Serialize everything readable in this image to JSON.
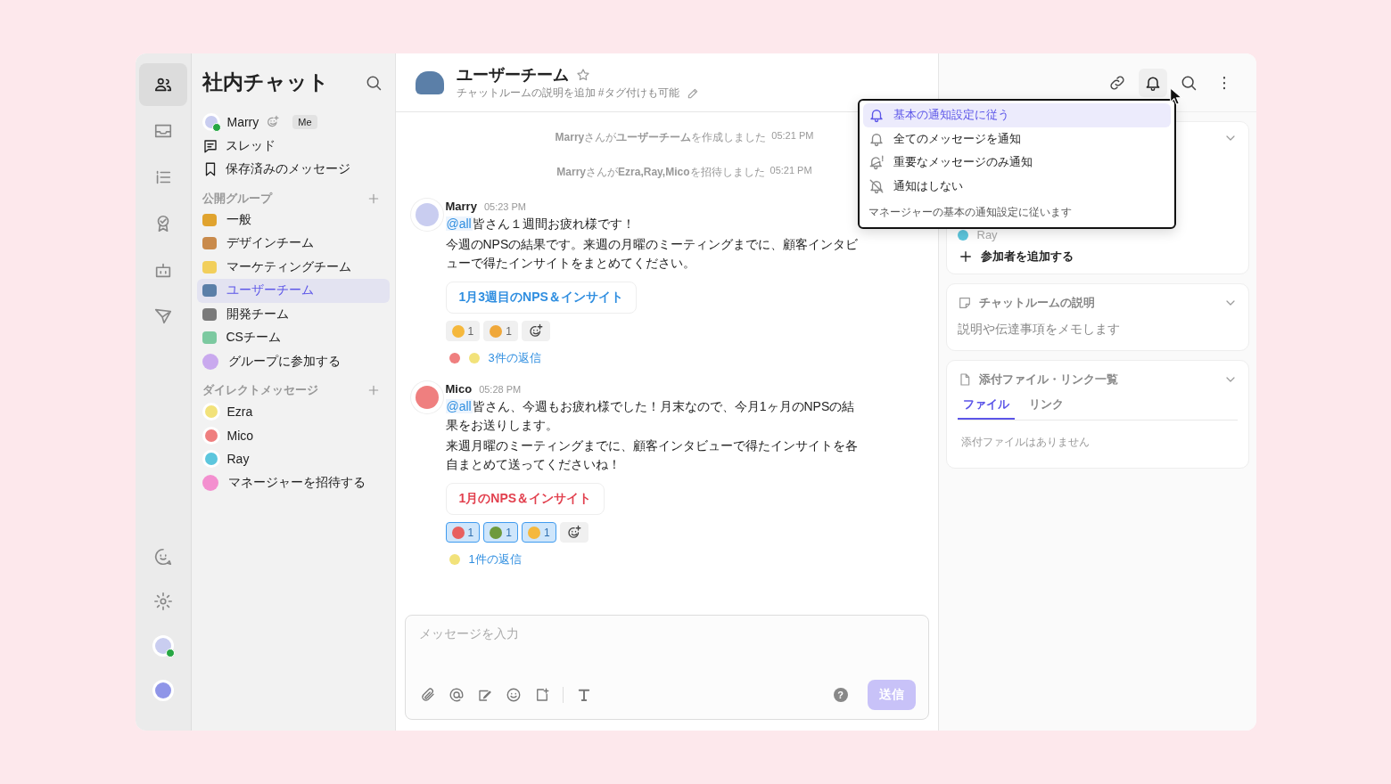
{
  "rail": {
    "items": [
      {
        "selected": true
      },
      {
        "selected": false
      },
      {
        "selected": false
      },
      {
        "selected": false
      },
      {
        "selected": false
      },
      {
        "selected": false
      }
    ],
    "avatars": [
      {
        "color": "#c9cdf0",
        "online": true
      },
      {
        "color": "#8f95e8",
        "online": false
      }
    ]
  },
  "sidebar": {
    "title": "社内チャット",
    "me": {
      "name": "Marry",
      "badge": "Me",
      "color": "#c9cdf0",
      "online": true
    },
    "links": [
      "スレッド",
      "保存済みのメッセージ"
    ],
    "groups": {
      "title": "公開グループ",
      "items": [
        {
          "label": "一般",
          "color": "#e0a32e",
          "selected": false
        },
        {
          "label": "デザインチーム",
          "color": "#c98a4b",
          "selected": false
        },
        {
          "label": "マーケティングチーム",
          "color": "#f2cf5b",
          "selected": false
        },
        {
          "label": "ユーザーチーム",
          "color": "#5b7fa8",
          "selected": true
        },
        {
          "label": "開発チーム",
          "color": "#7a7a7a",
          "selected": false
        },
        {
          "label": "CSチーム",
          "color": "#7cc9a0",
          "selected": false
        }
      ],
      "action": "グループに参加する"
    },
    "dms": {
      "title": "ダイレクトメッセージ",
      "items": [
        {
          "name": "Ezra",
          "color": "#f2e27a"
        },
        {
          "name": "Mico",
          "color": "#ef7f7f"
        },
        {
          "name": "Ray",
          "color": "#5cc6dd"
        }
      ],
      "action": "マネージャーを招待する"
    }
  },
  "header": {
    "title": "ユーザーチーム",
    "description": "チャットルームの説明を追加 #タグ付けも可能"
  },
  "events": [
    {
      "text": "**Marry**さんが**ユーザーチーム**を作成しました",
      "time": "05:21 PM"
    },
    {
      "text": "**Marry**さんが**Ezra,Ray,Mico**を招待しました",
      "time": "05:21 PM"
    }
  ],
  "posts": [
    {
      "author": "Marry",
      "time": "05:23 PM",
      "color": "#c9cdf0",
      "mention": "@all",
      "paragraphs": [
        "皆さん１週間お疲れ様です！",
        "今週のNPSの結果です。来週の月曜のミーティングまでに、顧客インタビューで得たインサイトをまとめてください。"
      ],
      "attachment": {
        "label": "1月3週目のNPS＆インサイト",
        "color": "#2f8ee0"
      },
      "reactions": [
        {
          "count": "1",
          "color": "#f5b83d",
          "selected": false
        },
        {
          "count": "1",
          "color": "#f0a83a",
          "selected": false
        }
      ],
      "replies": {
        "text": "3件の返信",
        "avatars": [
          {
            "color": "#ef7f7f"
          },
          {
            "color": "#f2e27a"
          }
        ]
      }
    },
    {
      "author": "Mico",
      "time": "05:28 PM",
      "color": "#ef7f7f",
      "mention": "@all",
      "paragraphs": [
        "皆さん、今週もお疲れ様でした！月末なので、今月1ヶ月のNPSの結果をお送りします。",
        "来週月曜のミーティングまでに、顧客インタビューで得たインサイトを各自まとめて送ってくださいね！"
      ],
      "attachment": {
        "label": "1月のNPS＆インサイト",
        "color": "#e2414f"
      },
      "reactions": [
        {
          "count": "1",
          "color": "#e8605f",
          "selected": true
        },
        {
          "count": "1",
          "color": "#6e9a3c",
          "selected": true
        },
        {
          "count": "1",
          "color": "#f5b83d",
          "selected": true
        }
      ],
      "replies": {
        "text": "1件の返信",
        "avatars": [
          {
            "color": "#f2e27a"
          }
        ]
      }
    }
  ],
  "composer": {
    "placeholder": "メッセージを入力",
    "help": "?",
    "send": {
      "label": "送信",
      "disabled": true
    }
  },
  "notify_menu": {
    "options": [
      {
        "label": "基本の通知設定に従う",
        "selected": true
      },
      {
        "label": "全てのメッセージを通知",
        "selected": false
      },
      {
        "label": "重要なメッセージのみ通知",
        "selected": false
      },
      {
        "label": "通知はしない",
        "selected": false
      }
    ],
    "note": "マネージャーの基本の通知設定に従います"
  },
  "panel": {
    "members": {
      "participant": {
        "name": "Ray",
        "color": "#5cc6dd"
      },
      "add": "参加者を追加する"
    },
    "description": {
      "title": "チャットルームの説明",
      "placeholder": "説明や伝達事項をメモします"
    },
    "files": {
      "title": "添付ファイル・リンク一覧",
      "tabs": [
        {
          "label": "ファイル",
          "selected": true
        },
        {
          "label": "リンク",
          "selected": false
        }
      ],
      "empty": "添付ファイルはありません"
    }
  }
}
